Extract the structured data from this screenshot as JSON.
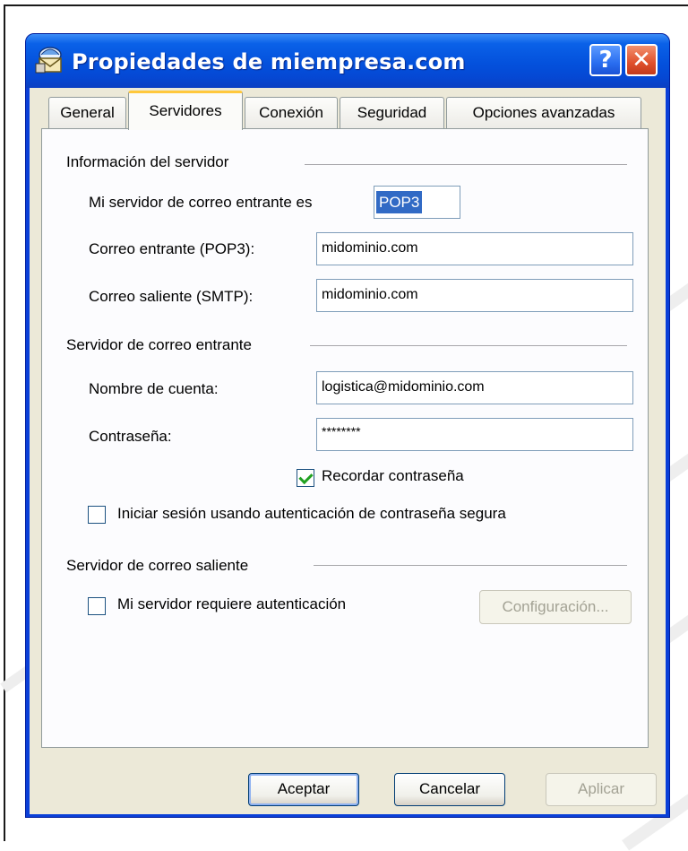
{
  "window": {
    "title": "Propiedades de miempresa.com",
    "help_label": "?",
    "close_label": "✕"
  },
  "tabs": [
    {
      "label": "General"
    },
    {
      "label": "Servidores"
    },
    {
      "label": "Conexión"
    },
    {
      "label": "Seguridad"
    },
    {
      "label": "Opciones avanzadas"
    }
  ],
  "server_info": {
    "group_title": "Información del servidor",
    "incoming_type_label": "Mi servidor de correo entrante es",
    "incoming_type_value": "POP3",
    "incoming_label": "Correo entrante (POP3):",
    "incoming_value": "midominio.com",
    "outgoing_label": "Correo saliente (SMTP):",
    "outgoing_value": "midominio.com"
  },
  "incoming_server": {
    "group_title": "Servidor de correo entrante",
    "account_label": "Nombre de cuenta:",
    "account_value": "logistica@midominio.com",
    "password_label": "Contraseña:",
    "password_value": "********",
    "remember_label": "Recordar contraseña",
    "remember_checked": true,
    "spa_label": "Iniciar sesión usando autenticación de contraseña segura",
    "spa_checked": false
  },
  "outgoing_server": {
    "group_title": "Servidor de correo saliente",
    "auth_label": "Mi servidor requiere autenticación",
    "auth_checked": false,
    "settings_label": "Configuración..."
  },
  "footer": {
    "ok_label": "Aceptar",
    "cancel_label": "Cancelar",
    "apply_label": "Aplicar"
  },
  "colors": {
    "titlebar": "#0451dc",
    "dialog_face": "#ece9d8",
    "selection": "#316ac5",
    "active_tab_accent": "#ffc83c"
  }
}
